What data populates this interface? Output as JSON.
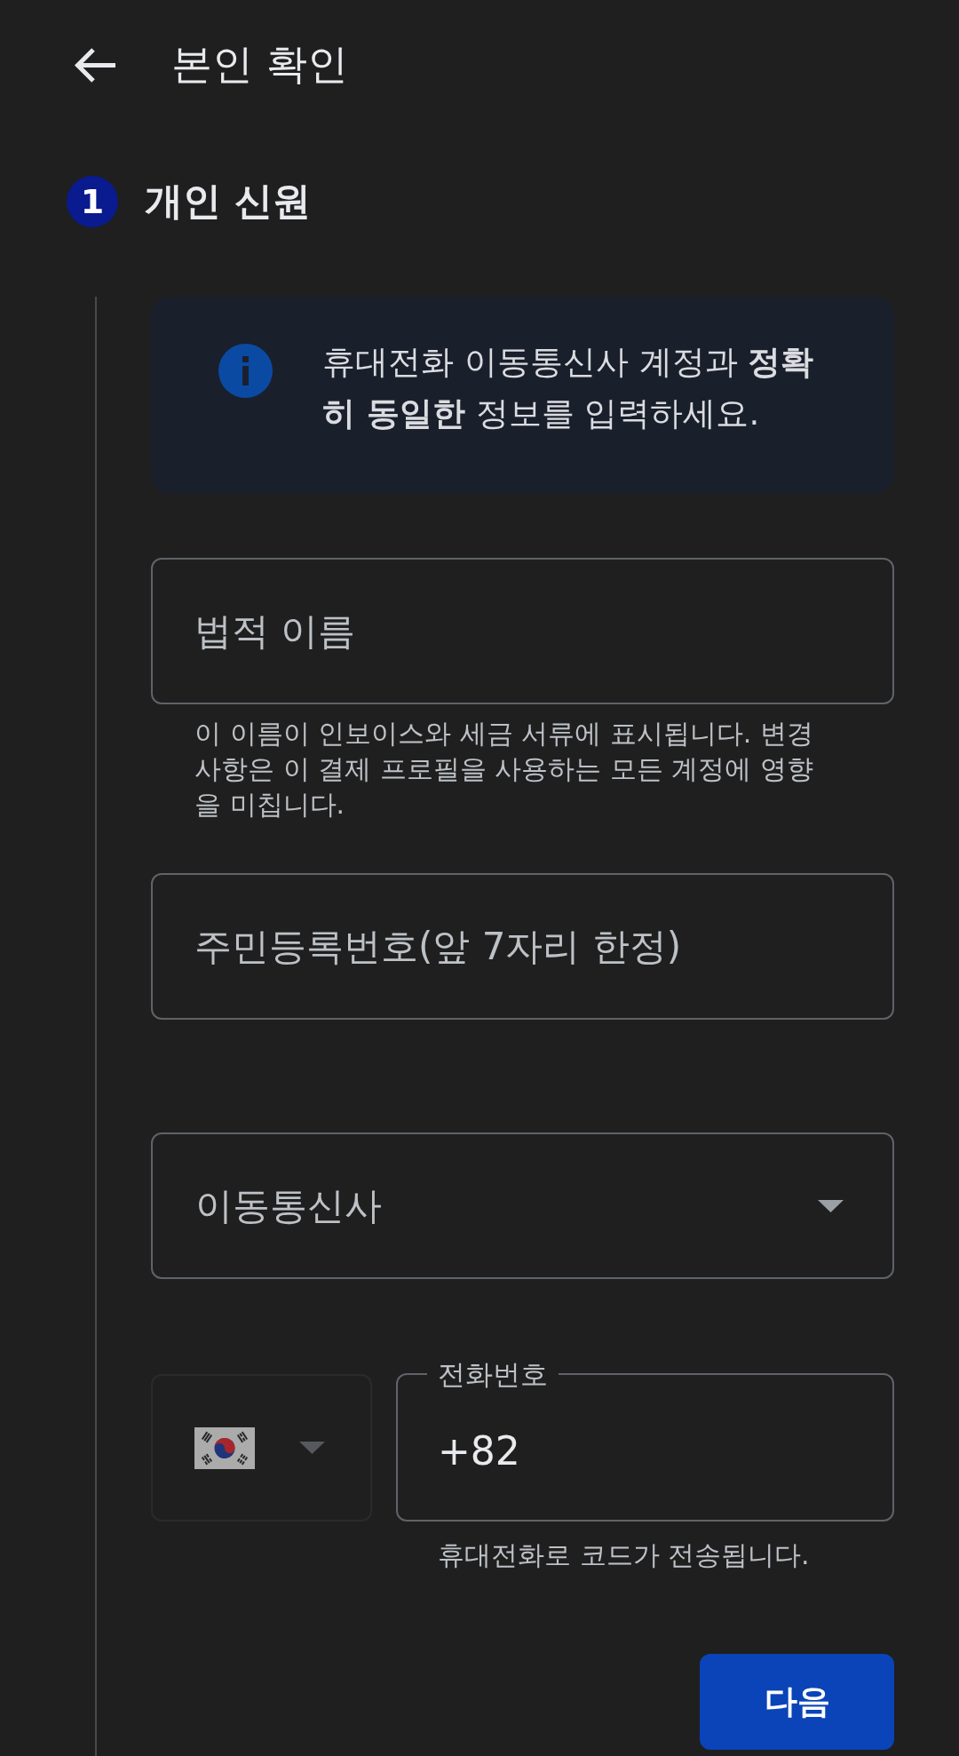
{
  "app_bar": {
    "title": "본인 확인"
  },
  "step": {
    "number": "1",
    "title": "개인 신원",
    "active": true
  },
  "notice": {
    "text": "휴대전화 이동통신사 계정과 **정확히 동일한** 정보를 입력하세요."
  },
  "fields": [
    {
      "kind": "text",
      "placeholder": "법적 이름",
      "helper": "이 이름이 인보이스와 세금 서류에 표시됩니다. 변경사항은 이 결제 프로필을 사용하는 모든 계정에 영향을 미칩니다."
    },
    {
      "kind": "text",
      "placeholder": "주민등록번호(앞 7자리 한정)"
    },
    {
      "kind": "select",
      "placeholder": "이동통신사"
    }
  ],
  "phone": {
    "country_picker": {
      "disabled": true
    },
    "label": "전화번호",
    "value": "+82",
    "helper": "휴대전화로 코드가 전송됩니다."
  },
  "buttons": [
    {
      "kind": "primary",
      "label": "다음"
    }
  ]
}
